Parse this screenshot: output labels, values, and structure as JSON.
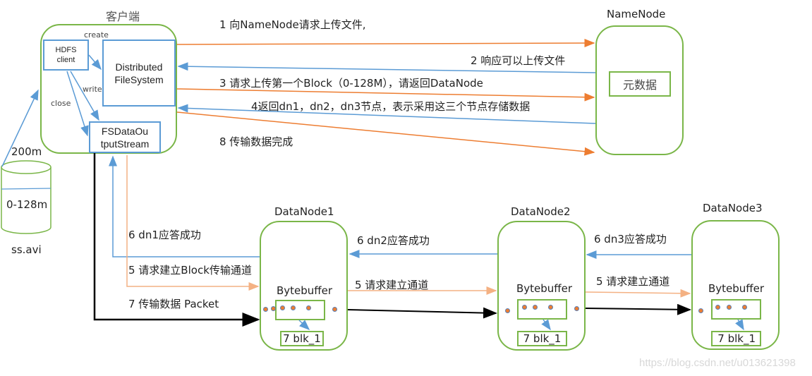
{
  "client": {
    "title": "客户端",
    "hdfs_client": "HDFS\nclient",
    "dfs": "Distributed\nFileSystem",
    "fsdos": "FSDataOu\ntputStream",
    "create_label": "create",
    "write_label": "write",
    "close_label": "close"
  },
  "file": {
    "size_label": "200m",
    "block_label": "0-128m",
    "name": "ss.avi"
  },
  "namenode": {
    "title": "NameNode",
    "metadata": "元数据"
  },
  "steps": {
    "s1": "1 向NameNode请求上传文件,",
    "s2": "2 响应可以上传文件",
    "s3": "3 请求上传第一个Block（0-128M），请返回DataNode",
    "s4": "4返回dn1，dn2，dn3节点，表示采用这三个节点存储数据",
    "s8": "8 传输数据完成",
    "s6_dn1": "6 dn1应答成功",
    "s5_dn1": "5 请求建立Block传输通道",
    "s7": "7 传输数据  Packet",
    "s6_dn2": "6 dn2应答成功",
    "s5_dn2": "5 请求建立通道",
    "s6_dn3": "6 dn3应答成功",
    "s5_dn3": "5 请求建立通道"
  },
  "datanodes": [
    {
      "title": "DataNode1",
      "buffer": "Bytebuffer",
      "block": "7 blk_1"
    },
    {
      "title": "DataNode2",
      "buffer": "Bytebuffer",
      "block": "7 blk_1"
    },
    {
      "title": "DataNode3",
      "buffer": "Bytebuffer",
      "block": "7 blk_1"
    }
  ],
  "colors": {
    "green": "#7ab648",
    "blue": "#5b9bd5",
    "orange": "#ed7d31",
    "light_orange": "#f4b183",
    "black": "#000000"
  },
  "watermark": "https://blog.csdn.net/u013621398"
}
